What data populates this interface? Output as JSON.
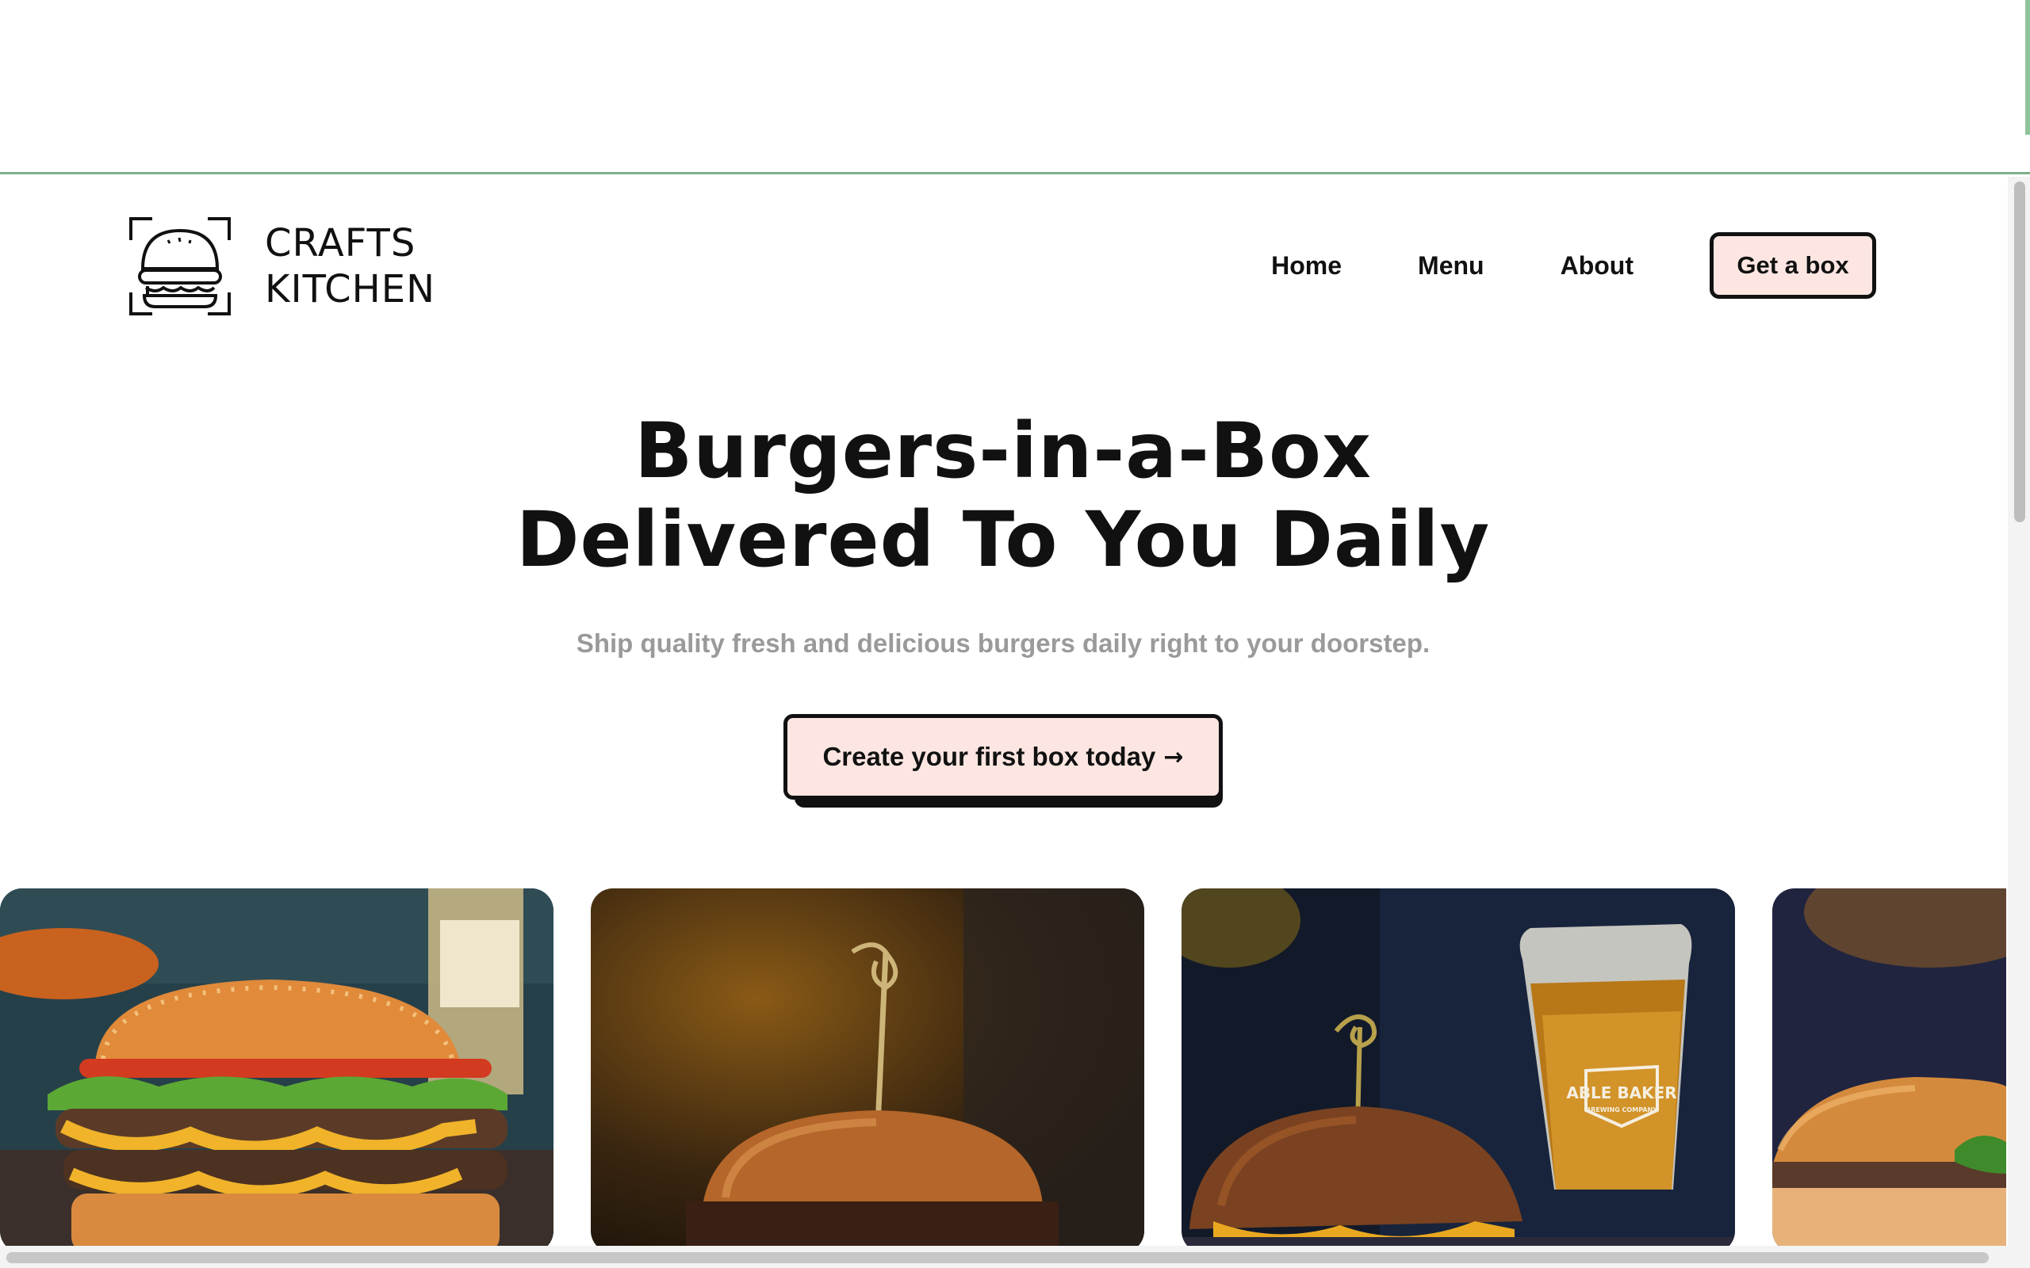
{
  "brand": {
    "name_line1": "CRAFTS",
    "name_line2": "KITCHEN",
    "logo_icon": "burger-icon"
  },
  "nav": {
    "items": [
      {
        "label": "Home"
      },
      {
        "label": "Menu"
      },
      {
        "label": "About"
      }
    ],
    "cta_label": "Get a box"
  },
  "hero": {
    "title_line1": "Burgers-in-a-Box",
    "title_line2": "Delivered To You Daily",
    "subtitle": "Ship quality fresh and delicious burgers daily right to your doorstep.",
    "cta_label": "Create your first box today",
    "cta_icon": "arrow-right-icon"
  },
  "gallery": {
    "images": [
      {
        "subject": "double-cheeseburger-photo"
      },
      {
        "subject": "burger-with-skewer-photo"
      },
      {
        "subject": "burger-and-beer-photo"
      },
      {
        "subject": "burger-photo"
      }
    ],
    "beer_glass_text_line1": "ABLE BAKER",
    "beer_glass_text_line2": "BREWING COMPANY"
  },
  "colors": {
    "cta_background": "#fde6e2",
    "text_primary": "#111111",
    "text_muted": "#9a9a9a",
    "topbar_border": "#7fb08a"
  }
}
